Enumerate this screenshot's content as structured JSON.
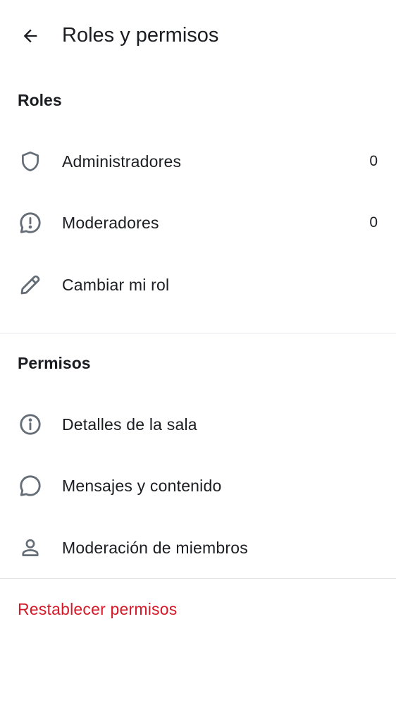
{
  "header": {
    "title": "Roles y permisos",
    "back_icon": "arrow-left-icon"
  },
  "roles_section": {
    "title": "Roles",
    "items": [
      {
        "icon": "shield-icon",
        "label": "Administradores",
        "count": "0"
      },
      {
        "icon": "alert-bubble-icon",
        "label": "Moderadores",
        "count": "0"
      },
      {
        "icon": "pencil-icon",
        "label": "Cambiar mi rol"
      }
    ]
  },
  "permissions_section": {
    "title": "Permisos",
    "items": [
      {
        "icon": "info-icon",
        "label": "Detalles de la sala"
      },
      {
        "icon": "chat-bubble-icon",
        "label": "Mensajes y contenido"
      },
      {
        "icon": "user-icon",
        "label": "Moderación de miembros"
      }
    ]
  },
  "reset": {
    "label": "Restablecer permisos",
    "color": "#d51928"
  },
  "colors": {
    "icon": "#656d77",
    "text": "#1b1d22",
    "divider": "#e6e7ea"
  }
}
